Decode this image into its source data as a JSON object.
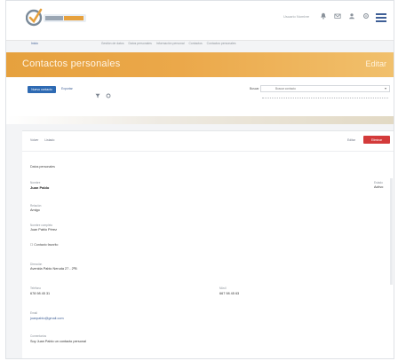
{
  "header": {
    "logo_text": "PortalGestion",
    "user_text": "Usuario Nombre",
    "icons": [
      "bell-icon",
      "mail-icon",
      "user-icon",
      "settings-icon"
    ],
    "menu_icon": "hamburger-icon"
  },
  "breadcrumb": {
    "home": "Inicio",
    "items": [
      "Gestión de datos",
      "Datos personales",
      "Información personal",
      "Contactos",
      "Contactos personales"
    ]
  },
  "page": {
    "title": "Contactos personales",
    "title_right": "Editar"
  },
  "toolbar": {
    "new_label": "Nuevo contacto",
    "secondary_label": "Exportar",
    "search_label": "Buscar",
    "search_placeholder": "Buscar contacto"
  },
  "card": {
    "back_label": "Volver",
    "list_label": "Listado",
    "edit_label": "Editar",
    "delete_label": "Eliminar",
    "section_title": "Datos personales",
    "fields": {
      "name_label": "Nombre",
      "name_value": "Juan Pablo",
      "status_label": "Estado",
      "status_value": "Activo",
      "relation_label": "Relación",
      "relation_value": "Amigo",
      "fullname_label": "Nombre completo",
      "fullname_value": "Juan Pablo Pérez",
      "check_label": "Contacto favorito",
      "address_label": "Dirección",
      "address_value": "Avenida Pablo Neruda 27 - 2ºB",
      "phone_label": "Teléfono",
      "phone_value": "678 98 45 31",
      "mobile_label": "Móvil",
      "mobile_value": "667 98 45 63",
      "email_label": "Email",
      "email_value": "juanpablo@gmail.com",
      "comments_label": "Comentarios",
      "comments_value": "Soy Juan Pablo un contacto personal"
    }
  },
  "colors": {
    "accent_orange": "#e6a13e",
    "primary_blue": "#2e6ab3",
    "danger_red": "#d33a3a"
  }
}
